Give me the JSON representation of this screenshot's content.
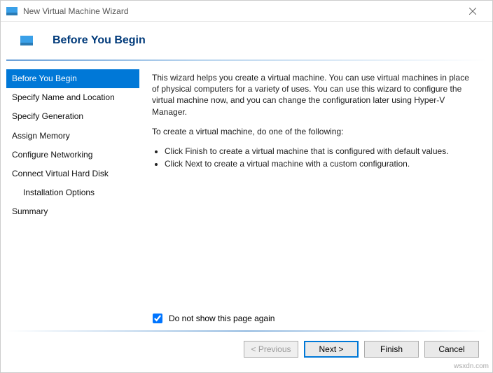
{
  "window": {
    "title": "New Virtual Machine Wizard"
  },
  "header": {
    "title": "Before You Begin"
  },
  "sidebar": {
    "items": [
      {
        "label": "Before You Begin",
        "selected": true
      },
      {
        "label": "Specify Name and Location"
      },
      {
        "label": "Specify Generation"
      },
      {
        "label": "Assign Memory"
      },
      {
        "label": "Configure Networking"
      },
      {
        "label": "Connect Virtual Hard Disk"
      },
      {
        "label": "Installation Options",
        "indent": true
      },
      {
        "label": "Summary"
      }
    ]
  },
  "content": {
    "intro": "This wizard helps you create a virtual machine. You can use virtual machines in place of physical computers for a variety of uses. You can use this wizard to configure the virtual machine now, and you can change the configuration later using Hyper-V Manager.",
    "subhead": "To create a virtual machine, do one of the following:",
    "bullets": [
      "Click Finish to create a virtual machine that is configured with default values.",
      "Click Next to create a virtual machine with a custom configuration."
    ],
    "checkbox_label": "Do not show this page again"
  },
  "buttons": {
    "previous": "< Previous",
    "next": "Next >",
    "finish": "Finish",
    "cancel": "Cancel"
  },
  "watermark": "wsxdn.com"
}
